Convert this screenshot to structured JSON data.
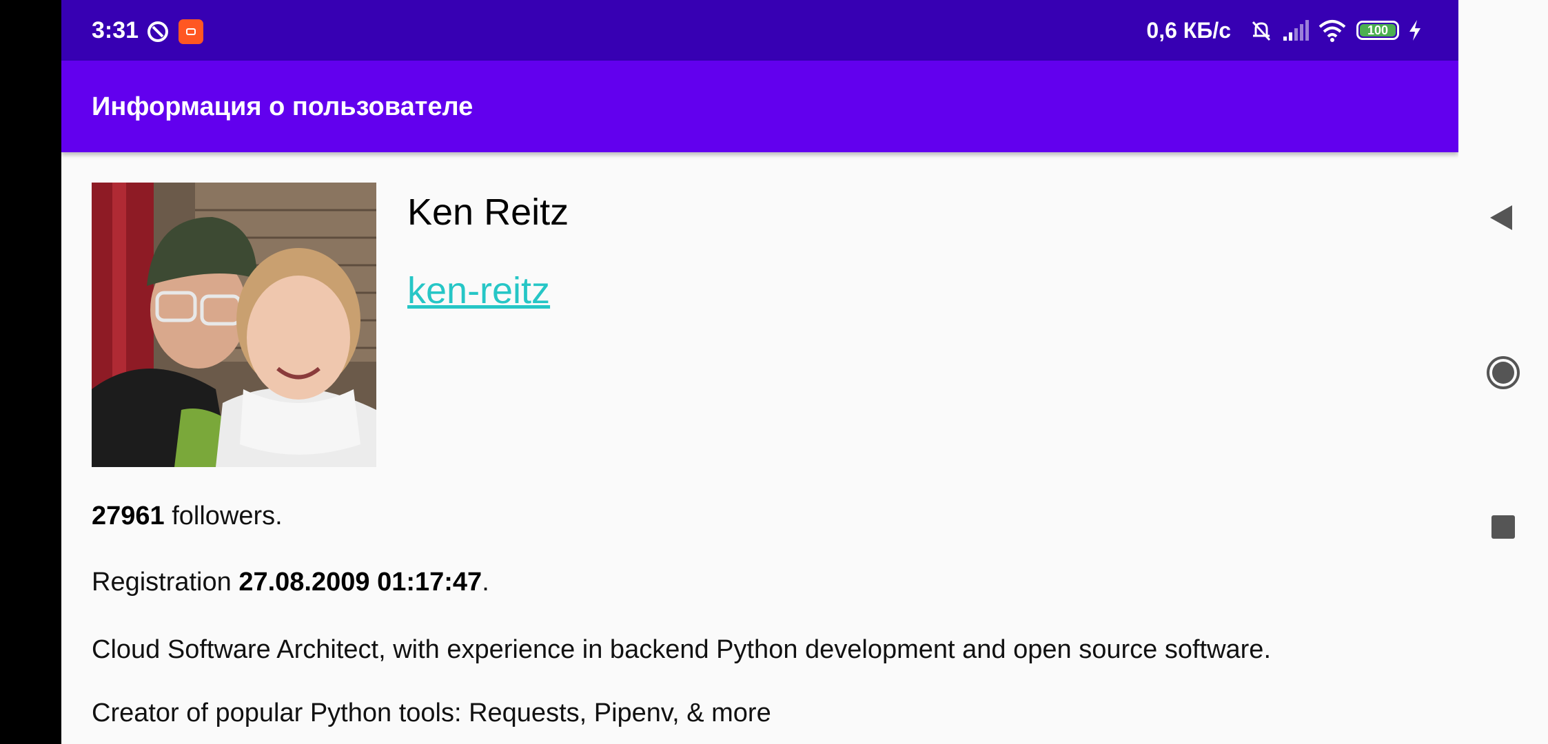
{
  "status_bar": {
    "time": "3:31",
    "network_speed": "0,6 КБ/с",
    "battery_level": "100"
  },
  "app_bar": {
    "title": "Информация о пользователе"
  },
  "user": {
    "name": "Ken Reitz",
    "login": "ken-reitz",
    "followers_count": "27961",
    "followers_suffix": " followers.",
    "registration_prefix": "Registration ",
    "registration_date": "27.08.2009 01:17:47",
    "registration_suffix": ".",
    "bio_line1": "Cloud Software Architect, with experience in backend Python development and open source software.",
    "bio_line2": "Creator of popular Python tools: Requests, Pipenv, & more"
  },
  "colors": {
    "status_bar": "#3700b3",
    "app_bar": "#6200ee",
    "link": "#26c6c6",
    "background": "#fafafa"
  },
  "icons": {
    "status": [
      "sync-icon",
      "app-notification-icon",
      "mute-bell-icon",
      "signal-icon",
      "wifi-icon",
      "battery-icon",
      "charging-icon"
    ],
    "nav": [
      "back-icon",
      "home-icon",
      "recents-icon"
    ]
  }
}
